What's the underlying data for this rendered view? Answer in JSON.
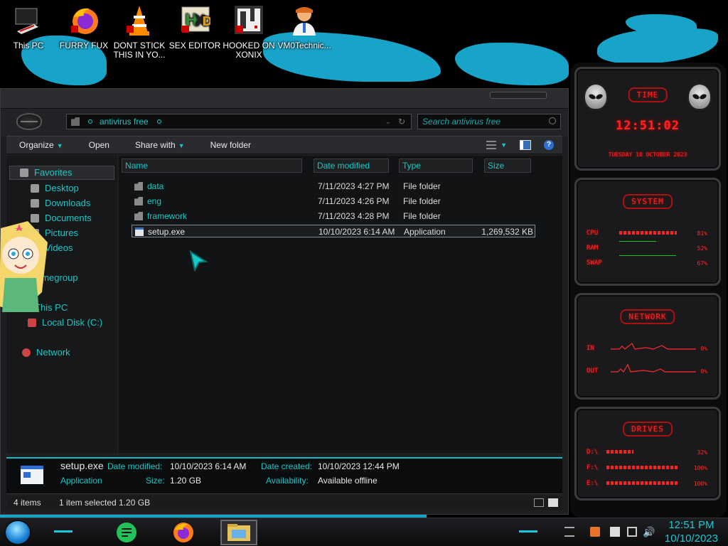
{
  "desktop": {
    "icons": [
      {
        "label": "This PC",
        "icon": "pc-icon"
      },
      {
        "label": "FURRY FUX",
        "icon": "firefox-icon"
      },
      {
        "label": "DONT STICK THIS IN YO...",
        "icon": "vlc-icon"
      },
      {
        "label": "SEX EDITOR",
        "icon": "hex-editor-icon"
      },
      {
        "label": "HOOKED ON XONIX",
        "icon": "xonix-icon"
      },
      {
        "label": "VM0Technic...",
        "icon": "doctor-icon"
      }
    ]
  },
  "explorer": {
    "address": "antivirus free",
    "search_placeholder": "Search antivirus free",
    "toolbar": {
      "organize": "Organize",
      "open": "Open",
      "share_with": "Share with",
      "new_folder": "New folder"
    },
    "nav": {
      "favorites": "Favorites",
      "desktop": "Desktop",
      "downloads": "Downloads",
      "documents": "Documents",
      "pictures": "Pictures",
      "videos": "Videos",
      "homegroup": "omegroup",
      "this_pc": "This PC",
      "local_disk": "Local Disk (C:)",
      "network": "Network"
    },
    "columns": {
      "name": "Name",
      "date_modified": "Date modified",
      "type": "Type",
      "size": "Size"
    },
    "files": [
      {
        "name": "data",
        "date": "7/11/2023 4:27 PM",
        "type": "File folder",
        "size": ""
      },
      {
        "name": "eng",
        "date": "7/11/2023 4:26 PM",
        "type": "File folder",
        "size": ""
      },
      {
        "name": "framework",
        "date": "7/11/2023 4:28 PM",
        "type": "File folder",
        "size": ""
      },
      {
        "name": "setup.exe",
        "date": "10/10/2023 6:14 AM",
        "type": "Application",
        "size": "1,269,532 KB"
      }
    ],
    "details": {
      "filename": "setup.exe",
      "filetype": "Application",
      "date_modified_label": "Date modified:",
      "date_modified": "10/10/2023 6:14 AM",
      "size_label": "Size:",
      "size": "1.20 GB",
      "date_created_label": "Date created:",
      "date_created": "10/10/2023 12:44 PM",
      "availability_label": "Availability:",
      "availability": "Available offline"
    },
    "status": {
      "items": "4 items",
      "selection": "1 item selected  1.20 GB"
    }
  },
  "gadget": {
    "time_title": "TIME",
    "time": "12:51:02",
    "date": "TUESDAY 10 OCTOBER 2023",
    "system_title": "SYSTEM",
    "cpu_label": "CPU",
    "cpu_val": "81%",
    "cpu_pct": 81,
    "ram_label": "RAM",
    "ram_val": "52%",
    "ram_pct": 52,
    "swap_label": "SWAP",
    "swap_val": "67%",
    "swap_pct": 67,
    "network_title": "NETWORK",
    "in_label": "IN",
    "in_val": "0%",
    "out_label": "OUT",
    "out_val": "0%",
    "drives_title": "DRIVES",
    "drive_c_label": "D:\\",
    "drive_c_val": "32%",
    "drive_c_pct": 32,
    "drive_f_label": "F:\\",
    "drive_f_val": "100%",
    "drive_f_pct": 100,
    "drive_e_label": "E:\\",
    "drive_e_val": "100%",
    "drive_e_pct": 100,
    "accent": "#ff2424"
  },
  "taskbar": {
    "time": "12:51 PM",
    "date": "10/10/2023",
    "apps": [
      "notes-icon",
      "firefox-icon",
      "file-explorer-icon"
    ]
  }
}
